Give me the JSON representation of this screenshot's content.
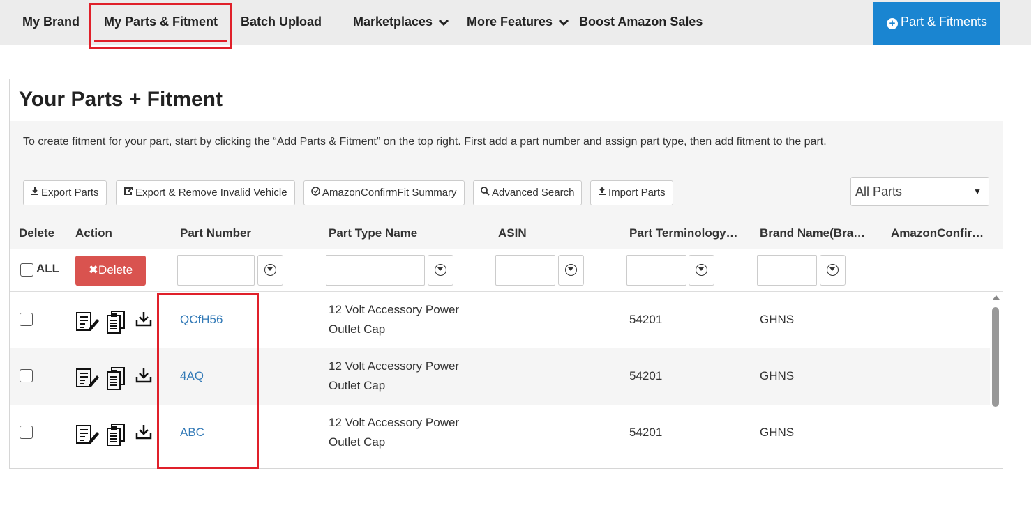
{
  "nav": {
    "items": [
      {
        "label": "My Brand"
      },
      {
        "label": "My Parts & Fitment"
      },
      {
        "label": "Batch Upload"
      },
      {
        "label": "Marketplaces"
      },
      {
        "label": "More Features"
      },
      {
        "label": "Boost Amazon Sales"
      }
    ],
    "add_button": "Part & Fitments"
  },
  "panel": {
    "title": "Your Parts + Fitment",
    "instructions": "To create fitment for your part, start by clicking the “Add Parts & Fitment” on the top right. First add a part number and assign part type, then add fitment to the part."
  },
  "toolbar": {
    "export_parts": "Export Parts",
    "export_remove": "Export & Remove Invalid Vehicle",
    "confirmfit_summary": "AmazonConfirmFit Summary",
    "advanced_search": "Advanced Search",
    "import_parts": "Import Parts",
    "filter_select": "All Parts"
  },
  "table": {
    "headers": {
      "delete": "Delete",
      "action": "Action",
      "part_number": "Part Number",
      "part_type_name": "Part Type Name",
      "asin": "ASIN",
      "part_terminology": "Part Terminology…",
      "brand_name": "Brand Name(Bra…",
      "amazon_confirm": "AmazonConfir…"
    },
    "all_label": "ALL",
    "delete_button": "Delete",
    "rows": [
      {
        "part_number": "QCfH56",
        "part_type_line1": "12 Volt Accessory Power",
        "part_type_line2": "Outlet Cap",
        "asin": "",
        "terminology": "54201",
        "brand": "GHNS"
      },
      {
        "part_number": "4AQ",
        "part_type_line1": "12 Volt Accessory Power",
        "part_type_line2": "Outlet Cap",
        "asin": "",
        "terminology": "54201",
        "brand": "GHNS"
      },
      {
        "part_number": "ABC",
        "part_type_line1": "12 Volt Accessory Power",
        "part_type_line2": "Outlet Cap",
        "asin": "",
        "terminology": "54201",
        "brand": "GHNS"
      }
    ]
  },
  "colors": {
    "accent_blue": "#1a85d1",
    "link_blue": "#337ab7",
    "delete_red": "#d9534f",
    "highlight_red": "#e0202a"
  }
}
